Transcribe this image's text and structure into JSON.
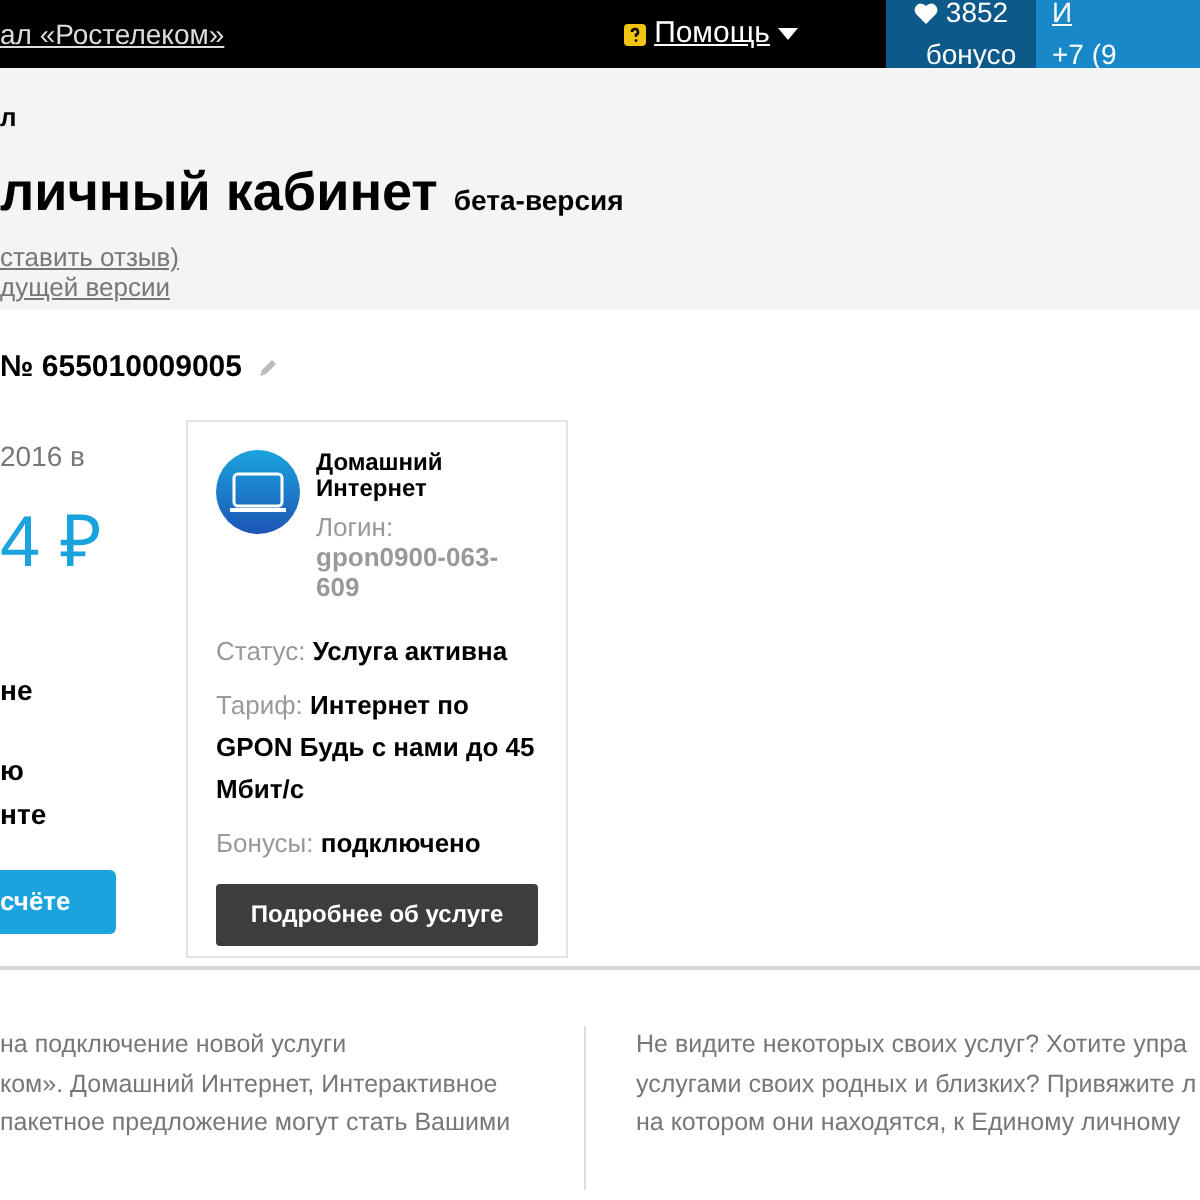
{
  "top_bar": {
    "portal_link": "ал «Ростелеком»",
    "help": "Помощь",
    "bonus": {
      "count": "3852",
      "label": "бонусо"
    },
    "account": {
      "name": "И",
      "phone": "+7 (9"
    }
  },
  "header": {
    "breadcrumb": "л",
    "title": "личный кабинет",
    "badge": "бета-версия",
    "links": [
      "ставить отзыв)",
      "дущей версии"
    ]
  },
  "account": {
    "number": "№ 655010009005",
    "balance_date": "2016 в",
    "balance": "4 ₽",
    "notes": [
      "не",
      "ю",
      "нте"
    ],
    "pay_button": "счёте"
  },
  "service_card": {
    "title": "Домашний Интернет",
    "login_label": "Логин:",
    "login": "gpon0900-063-609",
    "fields": [
      {
        "label": "Статус:",
        "value": "Услуга активна"
      },
      {
        "label": "Тариф:",
        "value": "Интернет по GPON Будь с нами до 45 Мбит/с"
      },
      {
        "label": "Бонусы:",
        "value": "подключено"
      }
    ],
    "button": "Подробнее об услуге"
  },
  "info": [
    [
      "на подключение новой услуги",
      "ком». Домашний Интернет, Интерактивное",
      "пакетное предложение могут стать Вашими"
    ],
    [
      "Не видите некоторых своих услуг? Хотите упра",
      "услугами своих родных и близких? Привяжите л",
      "на котором они находятся, к Единому личному"
    ]
  ]
}
